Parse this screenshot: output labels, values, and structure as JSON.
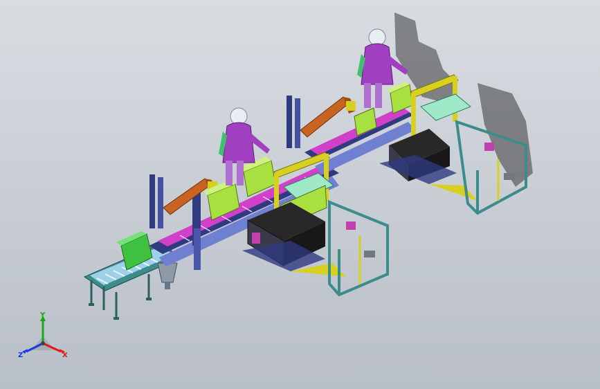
{
  "triad": {
    "x_label": "X",
    "y_label": "Y",
    "z_label": "Z",
    "x_color": "#e01818",
    "y_color": "#18a818",
    "z_color": "#1838e0"
  },
  "palette": {
    "frame_teal": "#3c8c8c",
    "frame_yellow": "#d8d020",
    "frame_navy": "#303a80",
    "belt_magenta": "#d040c8",
    "box_green": "#40c040",
    "box_lime": "#a8e040",
    "screen_black": "#181818",
    "robot_orange": "#c86420",
    "worker_purple": "#a040c0",
    "shadow": "#3a3a3a"
  },
  "icons": {
    "worker": "worker-icon",
    "triad": "axis-triad-icon"
  }
}
